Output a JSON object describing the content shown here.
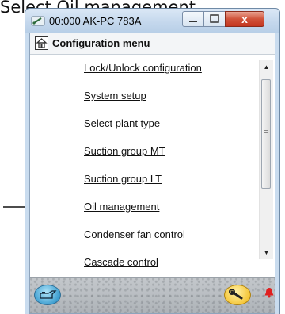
{
  "caption": "Select Oil management",
  "window": {
    "title": "00:000 AK-PC 783A",
    "close_glyph": "x",
    "app_icon": "meter-icon"
  },
  "menu": {
    "title": "Configuration menu",
    "items": [
      {
        "label": "Lock/Unlock configuration"
      },
      {
        "label": "System setup"
      },
      {
        "label": "Select plant type"
      },
      {
        "label": "Suction group MT"
      },
      {
        "label": "Suction group LT"
      },
      {
        "label": "Oil management"
      },
      {
        "label": "Condenser fan control"
      },
      {
        "label": "Cascade control"
      }
    ]
  },
  "bottom": {
    "left_icon": "oil-can-icon",
    "right_icon": "wrench-icon",
    "alarm_icon": "bell-icon",
    "colors": {
      "oil": "#3f9fd0",
      "wrench": "#f5c73a",
      "alarm": "#e02020"
    }
  }
}
